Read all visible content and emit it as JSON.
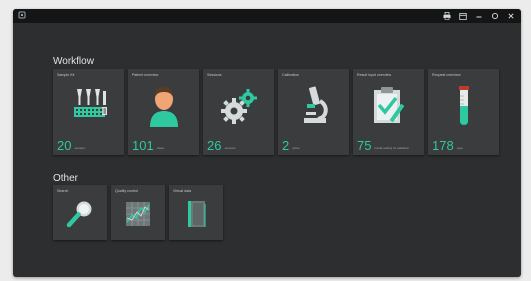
{
  "titlebar": {
    "app_icon": "app-icon",
    "icons": [
      "printer-icon",
      "calendar-icon",
      "minimize-icon",
      "maximize-icon",
      "close-icon"
    ]
  },
  "workflow": {
    "title": "Workflow",
    "tiles": [
      {
        "label": "Sample Kit",
        "count": "20",
        "caption": "samples",
        "icon": "sample-tubes-rack-icon"
      },
      {
        "label": "Patient overview",
        "count": "101",
        "caption": "cases",
        "icon": "patient-icon"
      },
      {
        "label": "Sessions",
        "count": "26",
        "caption": "sessions",
        "icon": "gears-icon"
      },
      {
        "label": "Calibration",
        "count": "2",
        "caption": "active",
        "icon": "microscope-icon"
      },
      {
        "label": "Result input overview",
        "count": "75",
        "caption": "results waiting for validation",
        "icon": "clipboard-check-icon"
      },
      {
        "label": "Request overview",
        "count": "178",
        "caption": "open",
        "icon": "test-tube-icon"
      }
    ]
  },
  "other": {
    "title": "Other",
    "tiles": [
      {
        "label": "Search",
        "icon": "magnifier-icon"
      },
      {
        "label": "Quality control",
        "icon": "qc-chart-icon"
      },
      {
        "label": "Virtual data",
        "icon": "book-icon"
      }
    ]
  },
  "colors": {
    "background": "#2c2e2f",
    "tile": "#3a3c3e",
    "accent": "#2ec8a1",
    "titlebar": "#141516"
  }
}
